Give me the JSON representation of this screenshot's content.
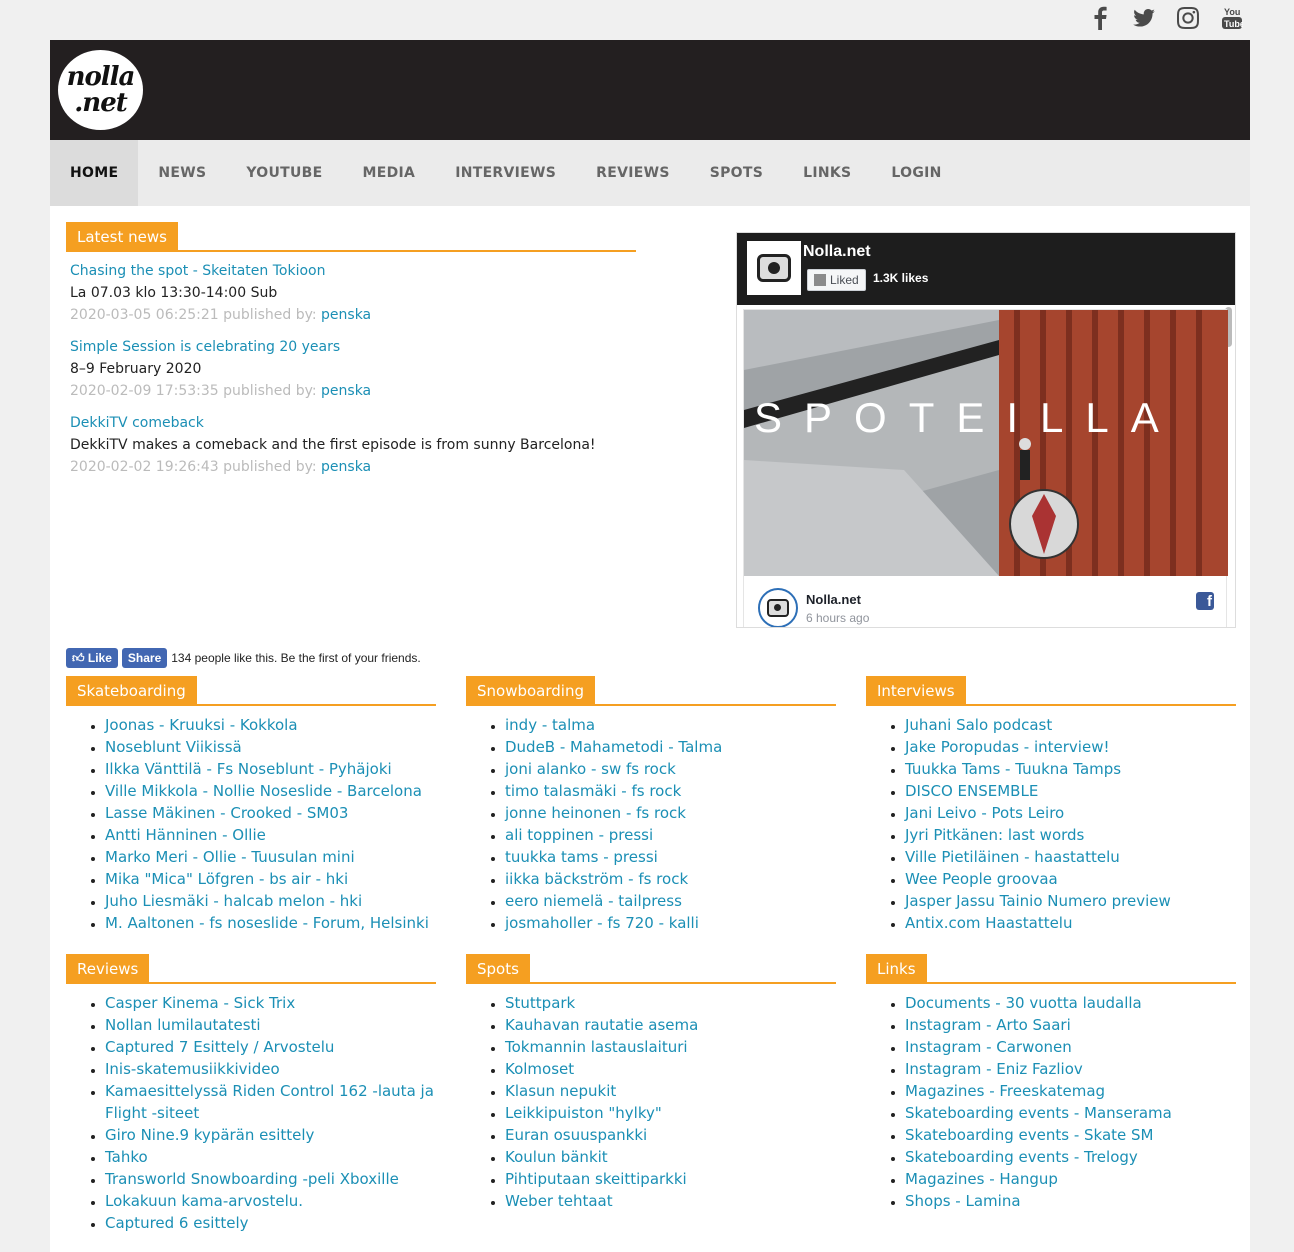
{
  "social": [
    "facebook-icon",
    "twitter-icon",
    "instagram-icon",
    "youtube-icon"
  ],
  "logo": {
    "line1": "nolla",
    "line2": ".net"
  },
  "nav": [
    "HOME",
    "NEWS",
    "YOUTUBE",
    "MEDIA",
    "INTERVIEWS",
    "REVIEWS",
    "SPOTS",
    "LINKS",
    "LOGIN"
  ],
  "latest": {
    "heading": "Latest news",
    "items": [
      {
        "title": "Chasing the spot - Skeitaten Tokioon",
        "text": "La 07.03 klo 13:30-14:00 Sub",
        "date": "2020-03-05 06:25:21",
        "published_by": "published by:",
        "author": "penska"
      },
      {
        "title": "Simple Session is celebrating 20 years",
        "text": "8–9 February 2020",
        "date": "2020-02-09 17:53:35",
        "published_by": "published by:",
        "author": "penska"
      },
      {
        "title": "DekkiTV comeback",
        "text": "DekkiTV makes a comeback and the first episode is from sunny Barcelona!",
        "date": "2020-02-02 19:26:43",
        "published_by": "published by:",
        "author": "penska"
      }
    ]
  },
  "fb_widget": {
    "page_name": "Nolla.net",
    "liked_label": "Liked",
    "likes": "1.3K likes",
    "post_image_text": "SPOTEILLA",
    "post_author": "Nolla.net",
    "post_time": "6 hours ago"
  },
  "like_bar": {
    "like": "Like",
    "share": "Share",
    "text": "134 people like this. Be the first of your friends."
  },
  "columns": [
    {
      "heading": "Skateboarding",
      "items": [
        "Joonas - Kruuksi - Kokkola",
        "Noseblunt Viikissä",
        "Ilkka Vänttilä - Fs Noseblunt - Pyhäjoki",
        "Ville Mikkola - Nollie Noseslide - Barcelona",
        "Lasse Mäkinen - Crooked - SM03",
        "Antti Hänninen - Ollie",
        "Marko Meri - Ollie - Tuusulan mini",
        "Mika \"Mica\" Löfgren - bs air - hki",
        "Juho Liesmäki - halcab melon - hki",
        "M. Aaltonen - fs noseslide - Forum, Helsinki"
      ]
    },
    {
      "heading": "Snowboarding",
      "items": [
        "indy - talma",
        "DudeB - Mahametodi - Talma",
        "joni alanko - sw fs rock",
        "timo talasmäki - fs rock",
        "jonne heinonen - fs rock",
        "ali toppinen - pressi",
        "tuukka tams - pressi",
        "iikka bäckström - fs rock",
        "eero niemelä - tailpress",
        "josmaholler - fs 720 - kalli"
      ]
    },
    {
      "heading": "Interviews",
      "items": [
        "Juhani Salo podcast",
        "Jake Poropudas - interview!",
        "Tuukka Tams - Tuukna Tamps",
        "DISCO ENSEMBLE",
        "Jani Leivo - Pots Leiro",
        "Jyri Pitkänen: last words",
        "Ville Pietiläinen - haastattelu",
        "Wee People groovaa",
        "Jasper Jassu Tainio Numero preview",
        "Antix.com Haastattelu"
      ]
    },
    {
      "heading": "Reviews",
      "items": [
        "Casper Kinema - Sick Trix",
        "Nollan lumilautatesti",
        "Captured 7 Esittely / Arvostelu",
        "Inis-skatemusiikkivideo",
        "Kamaesittelyssä Riden Control 162 -lauta ja Flight -siteet",
        "Giro Nine.9 kypärän esittely",
        "Tahko",
        "Transworld Snowboarding -peli Xboxille",
        "Lokakuun kama-arvostelu.",
        "Captured 6 esittely"
      ]
    },
    {
      "heading": "Spots",
      "items": [
        "Stuttpark",
        "Kauhavan rautatie asema",
        "Tokmannin lastauslaituri",
        "Kolmoset",
        "Klasun nepukit",
        "Leikkipuiston \"hylky\"",
        "Euran osuuspankki",
        "Koulun bänkit",
        "Pihtiputaan skeittiparkki",
        "Weber tehtaat"
      ]
    },
    {
      "heading": "Links",
      "items": [
        "Documents - 30 vuotta laudalla",
        "Instagram - Arto Saari",
        "Instagram - Carwonen",
        "Instagram - Eniz Fazliov",
        "Magazines - Freeskatemag",
        "Skateboarding events - Manserama",
        "Skateboarding events - Skate SM",
        "Skateboarding events - Trelogy",
        "Magazines - Hangup",
        "Shops - Lamina"
      ]
    }
  ]
}
